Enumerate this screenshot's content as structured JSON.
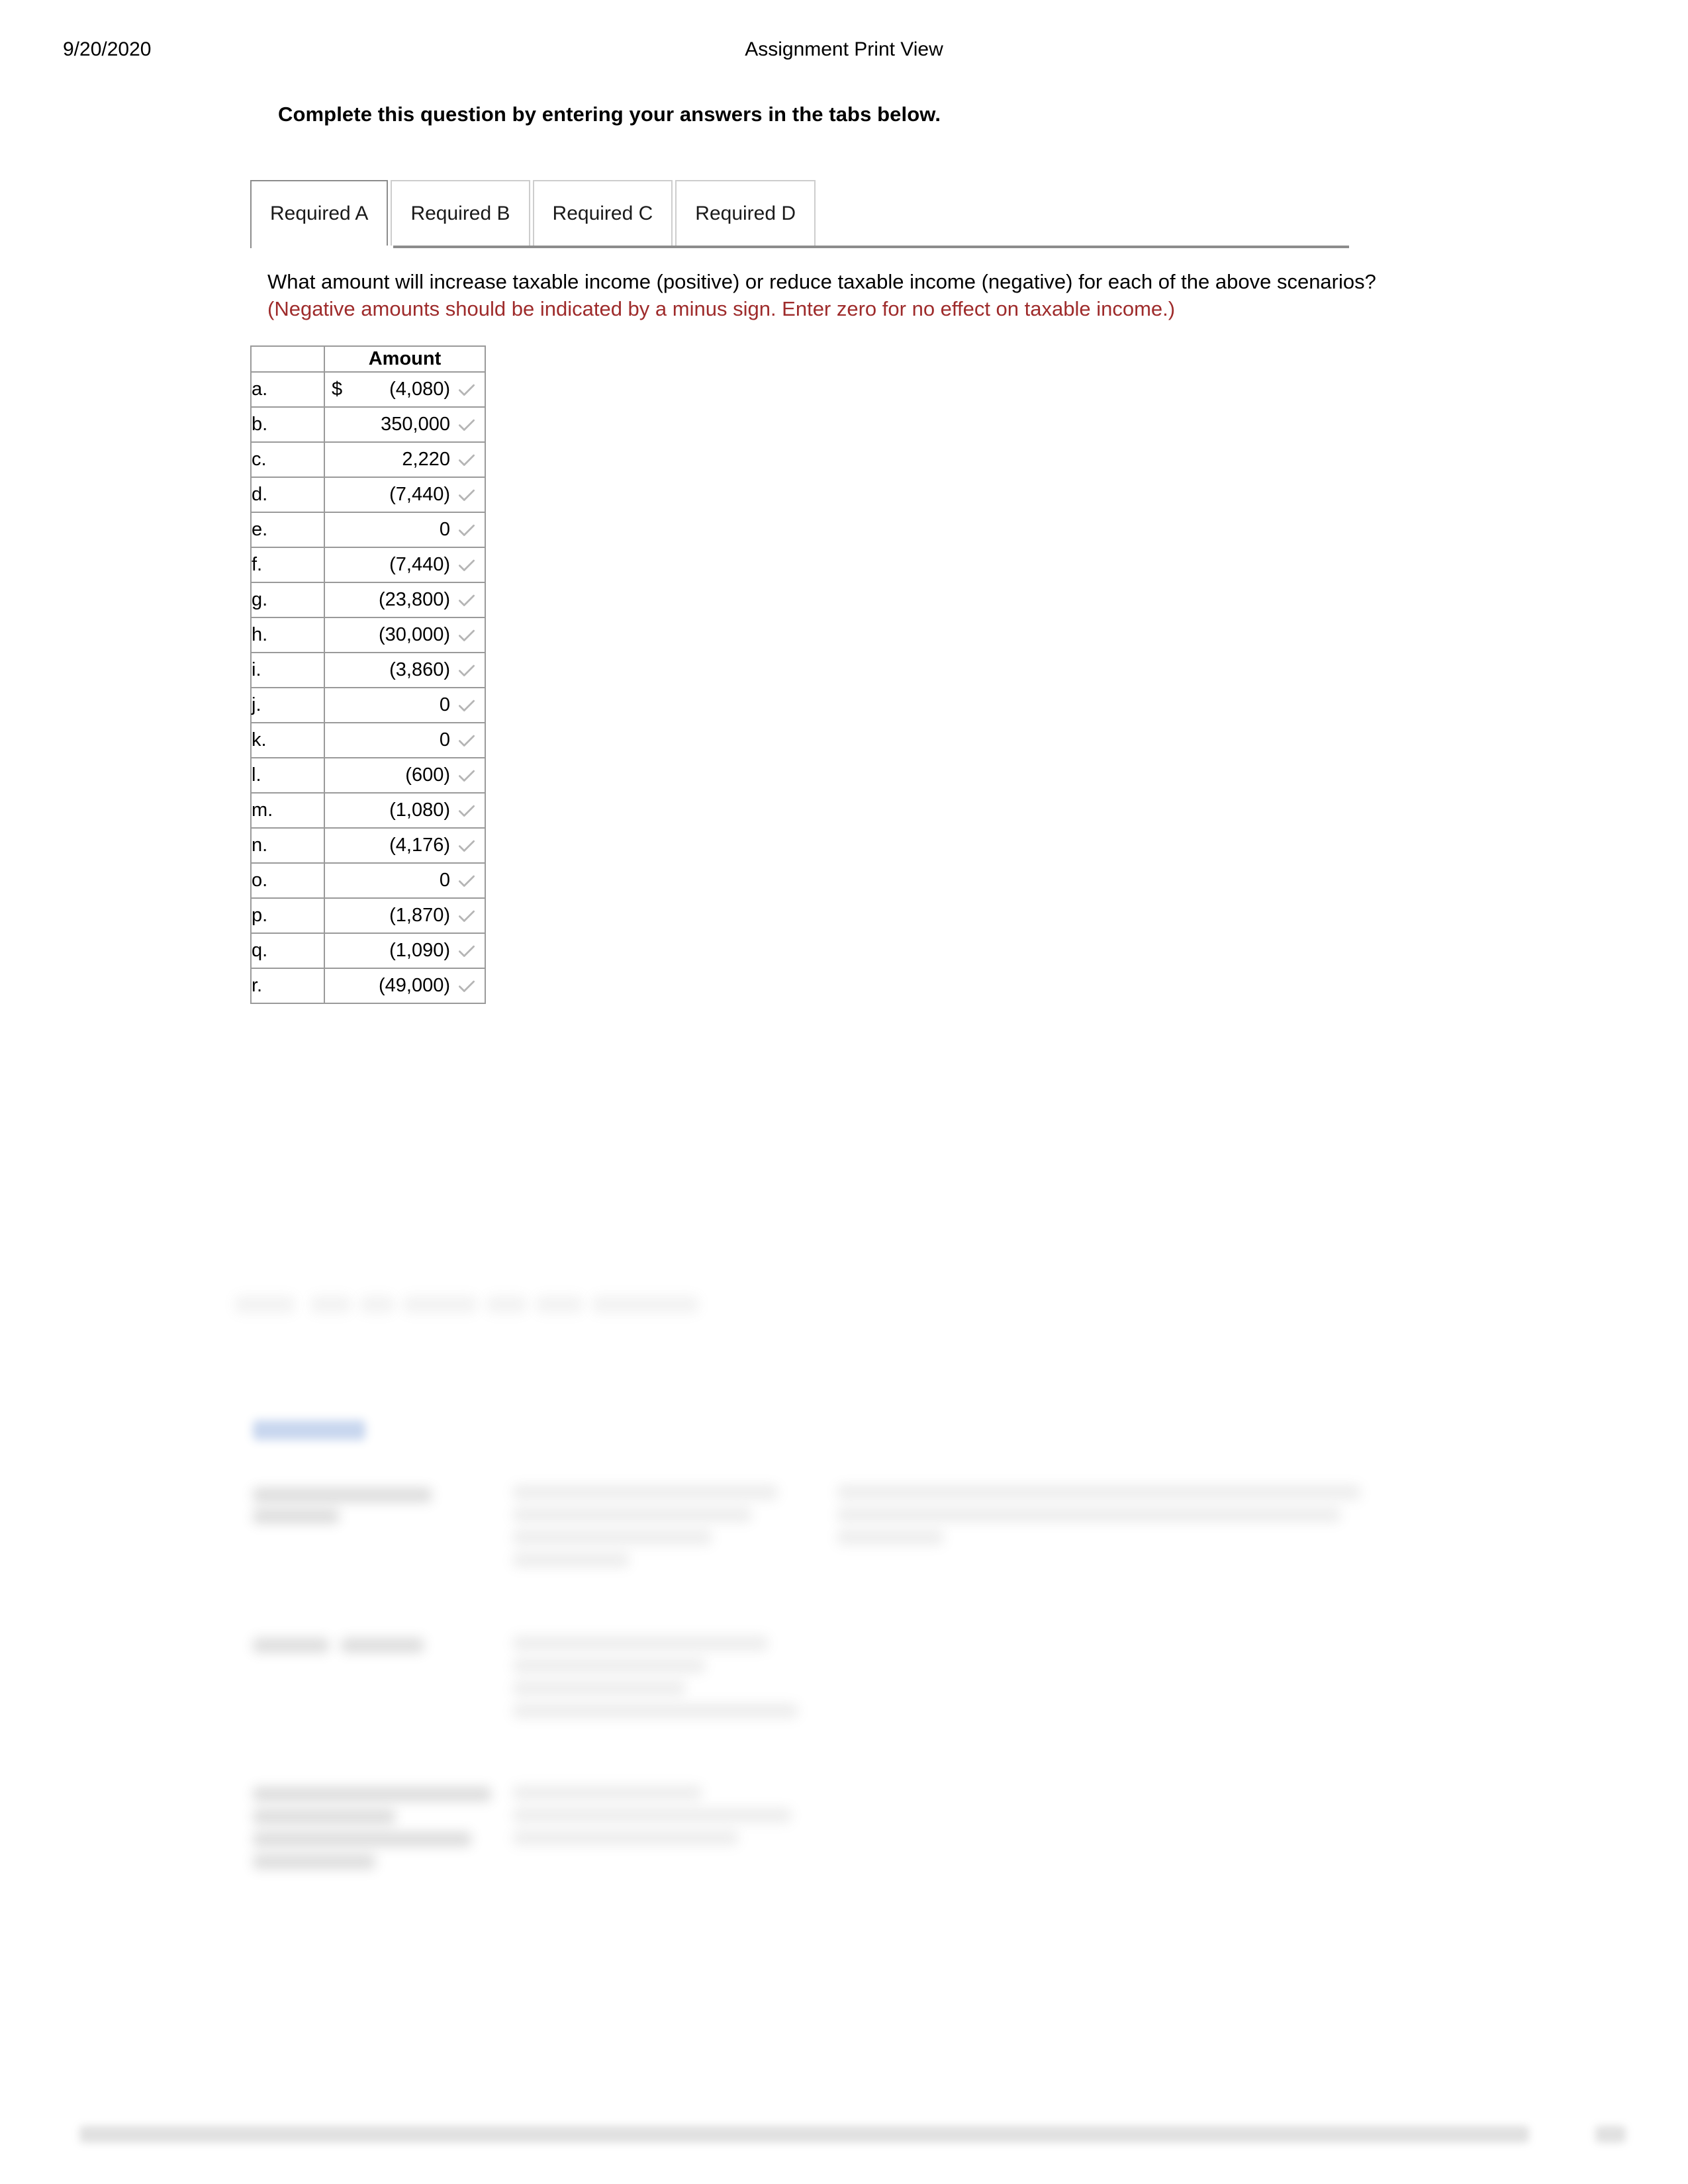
{
  "page": {
    "header_date": "9/20/2020",
    "header_title": "Assignment Print View"
  },
  "instructions": {
    "heading": "Complete this question by entering your answers in the tabs below."
  },
  "tabs": [
    {
      "label": "Required A",
      "active": true
    },
    {
      "label": "Required B",
      "active": false
    },
    {
      "label": "Required C",
      "active": false
    },
    {
      "label": "Required D",
      "active": false
    }
  ],
  "question": {
    "prompt": "What amount will increase taxable income (positive) or reduce taxable income (negative) for each of the above scenarios?",
    "note": "(Negative amounts should be indicated by a minus sign. Enter zero for no effect on taxable income.)",
    "note_color": "#9e2b2b"
  },
  "answer_table": {
    "columns": [
      "",
      "Amount"
    ],
    "currency_symbol": "$",
    "check_icon": "check-icon",
    "check_color": "#b5b5b5",
    "rows": [
      {
        "label": "a.",
        "currency": "$",
        "value": "(4,080)",
        "checked": true
      },
      {
        "label": "b.",
        "currency": "",
        "value": "350,000",
        "checked": true
      },
      {
        "label": "c.",
        "currency": "",
        "value": "2,220",
        "checked": true
      },
      {
        "label": "d.",
        "currency": "",
        "value": "(7,440)",
        "checked": true
      },
      {
        "label": "e.",
        "currency": "",
        "value": "0",
        "checked": true
      },
      {
        "label": "f.",
        "currency": "",
        "value": "(7,440)",
        "checked": true
      },
      {
        "label": "g.",
        "currency": "",
        "value": "(23,800)",
        "checked": true
      },
      {
        "label": "h.",
        "currency": "",
        "value": "(30,000)",
        "checked": true
      },
      {
        "label": "i.",
        "currency": "",
        "value": "(3,860)",
        "checked": true
      },
      {
        "label": "j.",
        "currency": "",
        "value": "0",
        "checked": true
      },
      {
        "label": "k.",
        "currency": "",
        "value": "0",
        "checked": true
      },
      {
        "label": "l.",
        "currency": "",
        "value": "(600)",
        "checked": true
      },
      {
        "label": "m.",
        "currency": "",
        "value": "(1,080)",
        "checked": true
      },
      {
        "label": "n.",
        "currency": "",
        "value": "(4,176)",
        "checked": true
      },
      {
        "label": "o.",
        "currency": "",
        "value": "0",
        "checked": true
      },
      {
        "label": "p.",
        "currency": "",
        "value": "(1,870)",
        "checked": true
      },
      {
        "label": "q.",
        "currency": "",
        "value": "(1,090)",
        "checked": true
      },
      {
        "label": "r.",
        "currency": "",
        "value": "(49,000)",
        "checked": true
      }
    ]
  },
  "obscured": {
    "note": "Lower page region and footer are rendered blurred/illegible in the source screenshot; no readable text available."
  }
}
